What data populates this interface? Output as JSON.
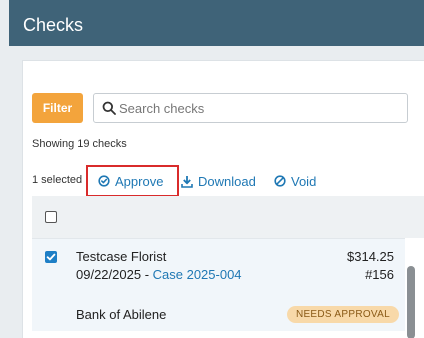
{
  "header": {
    "title": "Checks"
  },
  "toolbar": {
    "filter_label": "Filter",
    "search_placeholder": "Search checks"
  },
  "summary": {
    "showing": "Showing 19 checks"
  },
  "bulk": {
    "selected": "1 selected",
    "approve_label": "Approve",
    "download_label": "Download",
    "void_label": "Void"
  },
  "rows": [
    {
      "payee": "Testcase Florist",
      "date": "09/22/2025",
      "separator": " - ",
      "case": "Case 2025-004",
      "amount": "$314.25",
      "check_number": "#156",
      "bank": "Bank of Abilene",
      "status": "NEEDS APPROVAL",
      "selected": true
    }
  ],
  "colors": {
    "header_bg": "#3f6378",
    "filter_btn": "#f3a43c",
    "link": "#1f78b4",
    "highlight_border": "#d92b2b",
    "badge_bg": "#f8d9a9"
  }
}
